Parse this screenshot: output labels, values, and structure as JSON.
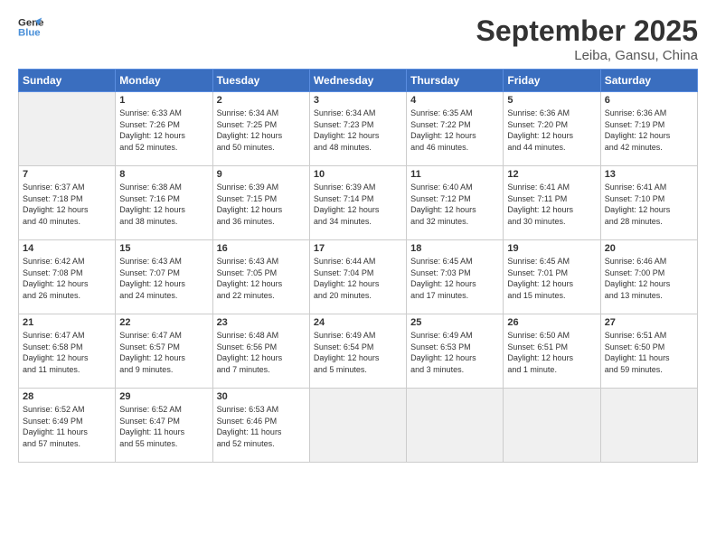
{
  "header": {
    "logo_line1": "General",
    "logo_line2": "Blue",
    "month": "September 2025",
    "location": "Leiba, Gansu, China"
  },
  "weekdays": [
    "Sunday",
    "Monday",
    "Tuesday",
    "Wednesday",
    "Thursday",
    "Friday",
    "Saturday"
  ],
  "weeks": [
    [
      {
        "day": "",
        "info": "",
        "empty": true
      },
      {
        "day": "1",
        "info": "Sunrise: 6:33 AM\nSunset: 7:26 PM\nDaylight: 12 hours\nand 52 minutes."
      },
      {
        "day": "2",
        "info": "Sunrise: 6:34 AM\nSunset: 7:25 PM\nDaylight: 12 hours\nand 50 minutes."
      },
      {
        "day": "3",
        "info": "Sunrise: 6:34 AM\nSunset: 7:23 PM\nDaylight: 12 hours\nand 48 minutes."
      },
      {
        "day": "4",
        "info": "Sunrise: 6:35 AM\nSunset: 7:22 PM\nDaylight: 12 hours\nand 46 minutes."
      },
      {
        "day": "5",
        "info": "Sunrise: 6:36 AM\nSunset: 7:20 PM\nDaylight: 12 hours\nand 44 minutes."
      },
      {
        "day": "6",
        "info": "Sunrise: 6:36 AM\nSunset: 7:19 PM\nDaylight: 12 hours\nand 42 minutes."
      }
    ],
    [
      {
        "day": "7",
        "info": "Sunrise: 6:37 AM\nSunset: 7:18 PM\nDaylight: 12 hours\nand 40 minutes."
      },
      {
        "day": "8",
        "info": "Sunrise: 6:38 AM\nSunset: 7:16 PM\nDaylight: 12 hours\nand 38 minutes."
      },
      {
        "day": "9",
        "info": "Sunrise: 6:39 AM\nSunset: 7:15 PM\nDaylight: 12 hours\nand 36 minutes."
      },
      {
        "day": "10",
        "info": "Sunrise: 6:39 AM\nSunset: 7:14 PM\nDaylight: 12 hours\nand 34 minutes."
      },
      {
        "day": "11",
        "info": "Sunrise: 6:40 AM\nSunset: 7:12 PM\nDaylight: 12 hours\nand 32 minutes."
      },
      {
        "day": "12",
        "info": "Sunrise: 6:41 AM\nSunset: 7:11 PM\nDaylight: 12 hours\nand 30 minutes."
      },
      {
        "day": "13",
        "info": "Sunrise: 6:41 AM\nSunset: 7:10 PM\nDaylight: 12 hours\nand 28 minutes."
      }
    ],
    [
      {
        "day": "14",
        "info": "Sunrise: 6:42 AM\nSunset: 7:08 PM\nDaylight: 12 hours\nand 26 minutes."
      },
      {
        "day": "15",
        "info": "Sunrise: 6:43 AM\nSunset: 7:07 PM\nDaylight: 12 hours\nand 24 minutes."
      },
      {
        "day": "16",
        "info": "Sunrise: 6:43 AM\nSunset: 7:05 PM\nDaylight: 12 hours\nand 22 minutes."
      },
      {
        "day": "17",
        "info": "Sunrise: 6:44 AM\nSunset: 7:04 PM\nDaylight: 12 hours\nand 20 minutes."
      },
      {
        "day": "18",
        "info": "Sunrise: 6:45 AM\nSunset: 7:03 PM\nDaylight: 12 hours\nand 17 minutes."
      },
      {
        "day": "19",
        "info": "Sunrise: 6:45 AM\nSunset: 7:01 PM\nDaylight: 12 hours\nand 15 minutes."
      },
      {
        "day": "20",
        "info": "Sunrise: 6:46 AM\nSunset: 7:00 PM\nDaylight: 12 hours\nand 13 minutes."
      }
    ],
    [
      {
        "day": "21",
        "info": "Sunrise: 6:47 AM\nSunset: 6:58 PM\nDaylight: 12 hours\nand 11 minutes."
      },
      {
        "day": "22",
        "info": "Sunrise: 6:47 AM\nSunset: 6:57 PM\nDaylight: 12 hours\nand 9 minutes."
      },
      {
        "day": "23",
        "info": "Sunrise: 6:48 AM\nSunset: 6:56 PM\nDaylight: 12 hours\nand 7 minutes."
      },
      {
        "day": "24",
        "info": "Sunrise: 6:49 AM\nSunset: 6:54 PM\nDaylight: 12 hours\nand 5 minutes."
      },
      {
        "day": "25",
        "info": "Sunrise: 6:49 AM\nSunset: 6:53 PM\nDaylight: 12 hours\nand 3 minutes."
      },
      {
        "day": "26",
        "info": "Sunrise: 6:50 AM\nSunset: 6:51 PM\nDaylight: 12 hours\nand 1 minute."
      },
      {
        "day": "27",
        "info": "Sunrise: 6:51 AM\nSunset: 6:50 PM\nDaylight: 11 hours\nand 59 minutes."
      }
    ],
    [
      {
        "day": "28",
        "info": "Sunrise: 6:52 AM\nSunset: 6:49 PM\nDaylight: 11 hours\nand 57 minutes."
      },
      {
        "day": "29",
        "info": "Sunrise: 6:52 AM\nSunset: 6:47 PM\nDaylight: 11 hours\nand 55 minutes."
      },
      {
        "day": "30",
        "info": "Sunrise: 6:53 AM\nSunset: 6:46 PM\nDaylight: 11 hours\nand 52 minutes."
      },
      {
        "day": "",
        "info": "",
        "empty": true
      },
      {
        "day": "",
        "info": "",
        "empty": true
      },
      {
        "day": "",
        "info": "",
        "empty": true
      },
      {
        "day": "",
        "info": "",
        "empty": true
      }
    ]
  ]
}
